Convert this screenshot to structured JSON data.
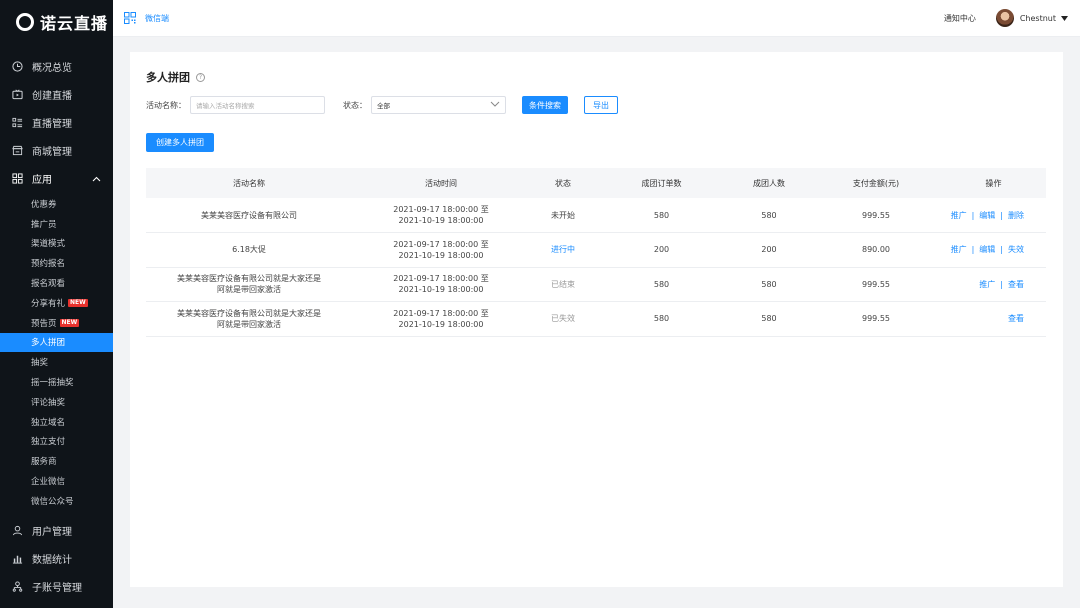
{
  "app": {
    "logo_text": "诺云直播"
  },
  "sidebar": {
    "items": [
      {
        "label": "概况总览",
        "icon": "clock-icon"
      },
      {
        "label": "创建直播",
        "icon": "tv-icon"
      },
      {
        "label": "直播管理",
        "icon": "list-icon"
      },
      {
        "label": "商城管理",
        "icon": "store-icon"
      },
      {
        "label": "应用",
        "icon": "grid-icon"
      }
    ],
    "sub_items": [
      {
        "label": "优惠券"
      },
      {
        "label": "推广员"
      },
      {
        "label": "渠道模式"
      },
      {
        "label": "预约报名"
      },
      {
        "label": "报名观看"
      },
      {
        "label": "分享有礼",
        "badge": "NEW"
      },
      {
        "label": "预告页",
        "badge": "NEW"
      },
      {
        "label": "多人拼团",
        "active": true
      },
      {
        "label": "抽奖"
      },
      {
        "label": "摇一摇抽奖"
      },
      {
        "label": "评论抽奖"
      },
      {
        "label": "独立域名"
      },
      {
        "label": "独立支付"
      },
      {
        "label": "服务商"
      },
      {
        "label": "企业微信"
      },
      {
        "label": "微信公众号"
      }
    ],
    "bottom_items": [
      {
        "label": "用户管理",
        "icon": "user-icon"
      },
      {
        "label": "数据统计",
        "icon": "bar-chart-icon"
      },
      {
        "label": "子账号管理",
        "icon": "sub-account-icon"
      }
    ]
  },
  "topbar": {
    "wechat_label": "微信端",
    "notify_label": "通知中心",
    "user_name": "Chestnut"
  },
  "page": {
    "title": "多人拼团",
    "filter_name_label": "活动名称：",
    "filter_name_placeholder": "请输入活动名称搜索",
    "filter_status_label": "状态：",
    "filter_status_value": "全部",
    "search_button": "条件搜索",
    "export_button": "导出",
    "create_button": "创建多人拼团"
  },
  "table": {
    "headers": [
      "活动名称",
      "活动时间",
      "状态",
      "成团订单数",
      "成团人数",
      "支付金额(元)",
      "操作"
    ],
    "rows": [
      {
        "name1": "美莱美容医疗设备有限公司",
        "name2": "",
        "time1": "2021-09-17 18:00:00 至",
        "time2": "2021-10-19 18:00:00",
        "status": "未开始",
        "orders": "580",
        "people": "580",
        "amount": "999.55",
        "ops": [
          "推广",
          "编辑",
          "删除"
        ]
      },
      {
        "name1": "6.18大促",
        "name2": "",
        "time1": "2021-09-17 18:00:00 至",
        "time2": "2021-10-19 18:00:00",
        "status": "进行中",
        "orders": "200",
        "people": "200",
        "amount": "890.00",
        "ops": [
          "推广",
          "编辑",
          "失效"
        ]
      },
      {
        "name1": "美莱美容医疗设备有限公司就是大家还是",
        "name2": "阿就是带回家激活",
        "time1": "2021-09-17 18:00:00 至",
        "time2": "2021-10-19 18:00:00",
        "status": "已结束",
        "orders": "580",
        "people": "580",
        "amount": "999.55",
        "ops": [
          "推广",
          "查看"
        ]
      },
      {
        "name1": "美莱美容医疗设备有限公司就是大家还是",
        "name2": "阿就是带回家激活",
        "time1": "2021-09-17 18:00:00 至",
        "time2": "2021-10-19 18:00:00",
        "status": "已失效",
        "orders": "580",
        "people": "580",
        "amount": "999.55",
        "ops": [
          "查看"
        ]
      }
    ]
  }
}
